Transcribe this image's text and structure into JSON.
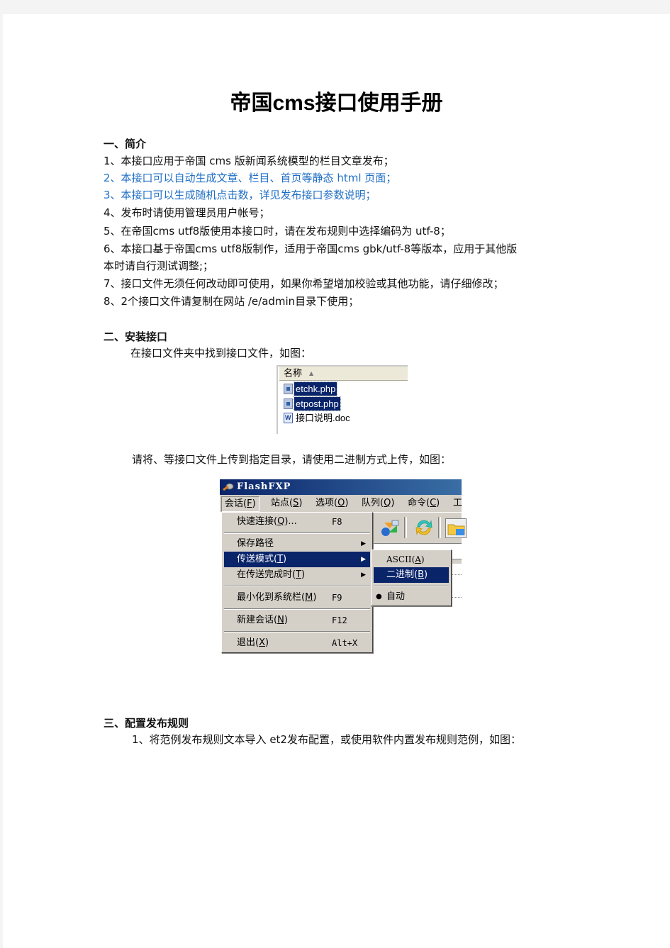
{
  "document": {
    "title": "帝国cms接口使用手册",
    "sections": [
      {
        "heading": "一、简介",
        "items": [
          {
            "text": "1、本接口应用于帝国 cms 版新闻系统模型的栏目文章发布；",
            "color": "#111111"
          },
          {
            "text": "2、本接口可以自动生成文章、栏目、首页等静态 html 页面；",
            "color": "#1f6fc5"
          },
          {
            "text": "3、本接口可以生成随机点击数，详见发布接口参数说明；",
            "color": "#1f6fc5"
          },
          {
            "text": "4、发布时请使用管理员用户帐号；",
            "color": "#111111"
          },
          {
            "text": "5、在帝国cms  utf8版使用本接口时，请在发布规则中选择编码为 utf-8；",
            "color": "#111111"
          },
          {
            "text": "6、本接口基于帝国cms  utf8版制作，适用于帝国cms  gbk/utf-8等版本，应用于其他版",
            "color": "#111111"
          },
          {
            "text": "本时请自行测试调整;；",
            "color": "#111111"
          },
          {
            "text": "7、接口文件无须任何改动即可使用，如果你希望增加校验或其他功能，请仔细修改；",
            "color": "#111111"
          },
          {
            "text": "8、2个接口文件请复制在网站 /e/admin目录下使用；",
            "color": "#111111"
          }
        ]
      },
      {
        "heading": "二、安装接口",
        "paragraph1": "在接口文件夹中找到接口文件，如图：",
        "paragraph2": "请将、等接口文件上传到指定目录，请使用二进制方式上传，如图："
      },
      {
        "heading": "三、配置发布规则",
        "paragraph1": "1、将范例发布规则文本导入 et2发布配置，或使用软件内置发布规则范例，如图："
      }
    ]
  },
  "file_list": {
    "column_header": "名称",
    "sort_indicator": "▲",
    "files": [
      {
        "name": "etchk.php",
        "icon": "php-file-icon",
        "selected": true
      },
      {
        "name": "etpost.php",
        "icon": "php-file-icon",
        "selected": true
      },
      {
        "name": "接口说明.doc",
        "icon": "word-doc-icon",
        "selected": false
      }
    ]
  },
  "flashfxp": {
    "window_title": "FlashFXP",
    "menubar": [
      {
        "label": "会话",
        "key": "F",
        "open": true
      },
      {
        "label": "站点",
        "key": "S"
      },
      {
        "label": "选项",
        "key": "O"
      },
      {
        "label": "队列",
        "key": "Q"
      },
      {
        "label": "命令",
        "key": "C"
      },
      {
        "label": "工",
        "key": ""
      }
    ],
    "session_menu": [
      {
        "label": "快速连接",
        "key": "Q",
        "suffix": "...",
        "shortcut": "F8"
      },
      {
        "separator": true
      },
      {
        "label": "保存路径",
        "submenu": true
      },
      {
        "label": "传送模式",
        "key": "T",
        "submenu": true,
        "highlighted": true
      },
      {
        "label": "在传送完成时",
        "key": "T",
        "submenu": true
      },
      {
        "separator": true
      },
      {
        "label": "最小化到系统栏",
        "key": "M",
        "shortcut": "F9"
      },
      {
        "separator": true
      },
      {
        "label": "新建会话",
        "key": "N",
        "shortcut": "F12"
      },
      {
        "separator": true
      },
      {
        "label": "退出",
        "key": "X",
        "shortcut": "Alt+X"
      }
    ],
    "transfer_mode_submenu": [
      {
        "label": "ASCII",
        "key": "A"
      },
      {
        "label": "二进制",
        "key": "B",
        "highlighted": true
      },
      {
        "separator": true
      },
      {
        "label": "自动",
        "checked": true
      }
    ],
    "toolbar_icons": [
      "transfer-icon",
      "refresh-icon",
      "folder-icon"
    ]
  },
  "colors": {
    "highlight": "#0a246a",
    "link_blue": "#1f6fc5",
    "menu_bg": "#d4d0c8"
  }
}
